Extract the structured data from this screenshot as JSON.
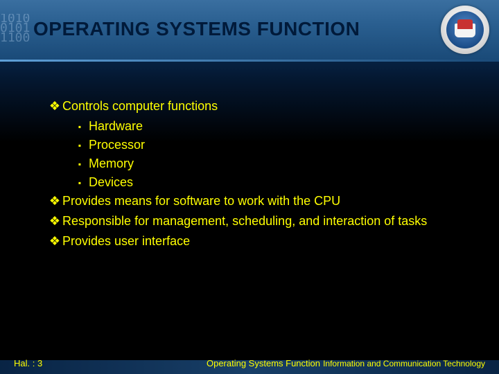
{
  "title": "OPERATING SYSTEMS FUNCTION",
  "bullets": {
    "b0": {
      "text": "Controls computer functions"
    },
    "b0_sub": {
      "s0": "Hardware",
      "s1": "Processor",
      "s2": "Memory",
      "s3": "Devices"
    },
    "b1": {
      "text": "Provides means for software to work with the CPU"
    },
    "b2": {
      "text": "Responsible for management, scheduling, and interaction of tasks"
    },
    "b3": {
      "text": "Provides user interface"
    }
  },
  "markers": {
    "diamond": "❖",
    "square": "▪"
  },
  "footer": {
    "left": "Hal. : 3",
    "center": "Operating Systems Function",
    "right": "Information and Communication Technology"
  },
  "decor": "1010\n0101\n1100"
}
